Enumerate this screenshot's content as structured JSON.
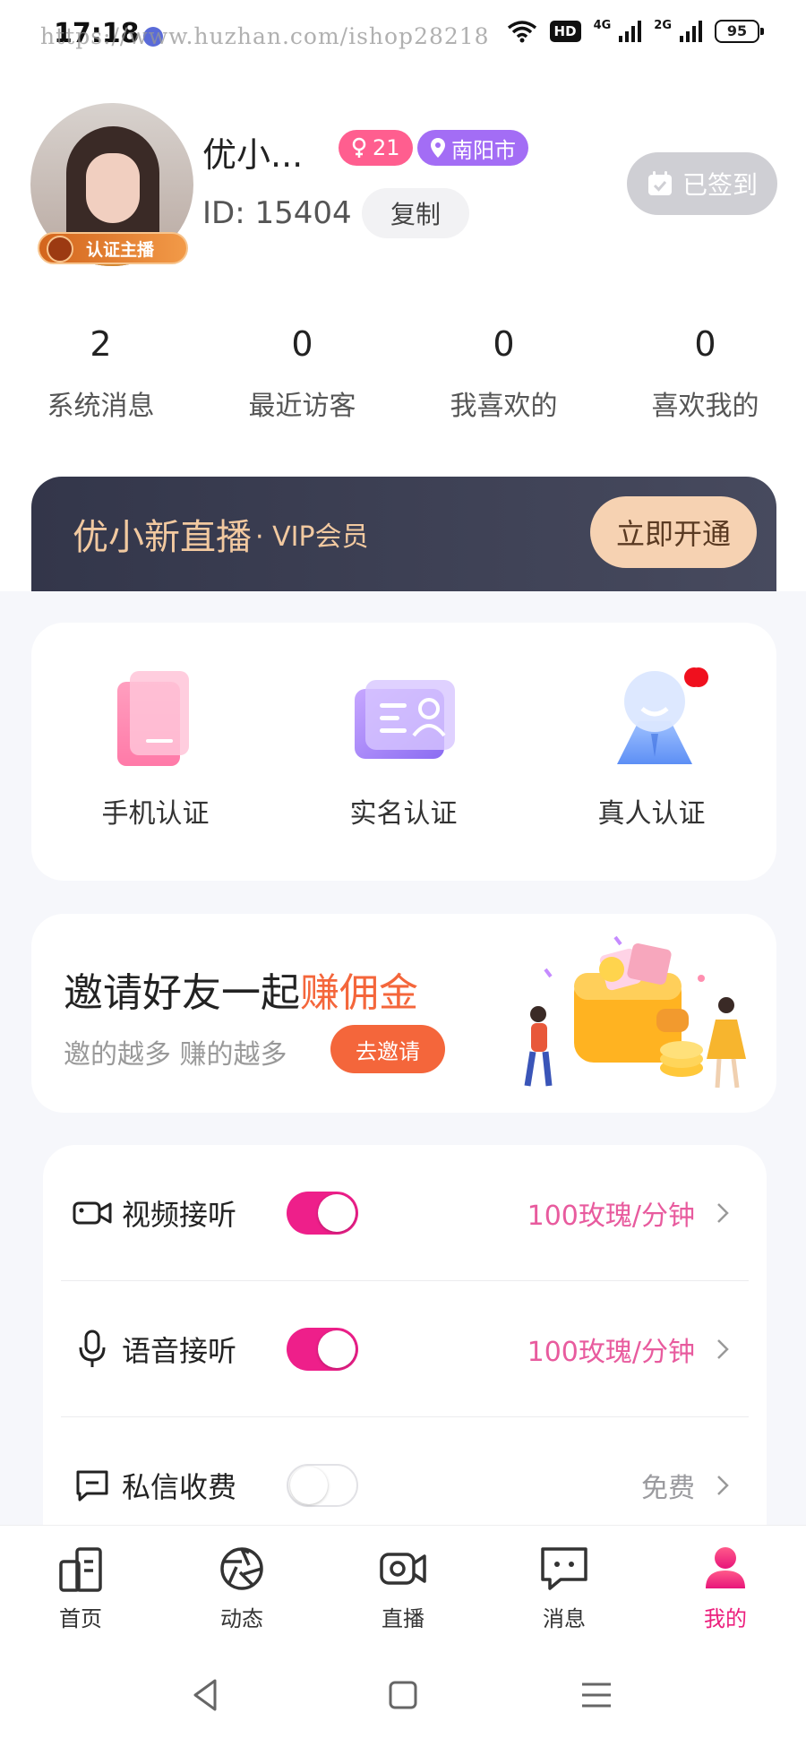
{
  "status_bar": {
    "time": "17:18",
    "watermark": "https://www.huzhan.com/ishop28218",
    "hd": "HD",
    "net1": "4G",
    "net2": "2G",
    "battery": "95"
  },
  "profile": {
    "nickname": "优小...",
    "age": "21",
    "city": "南阳市",
    "id_text": "ID: 15404",
    "copy_label": "复制",
    "cert_label": "认证主播",
    "signin_label": "已签到"
  },
  "stats": [
    {
      "value": "2",
      "label": "系统消息"
    },
    {
      "value": "0",
      "label": "最近访客"
    },
    {
      "value": "0",
      "label": "我喜欢的"
    },
    {
      "value": "0",
      "label": "喜欢我的"
    }
  ],
  "vip": {
    "title": "优小新直播",
    "subtitle": "· VIP会员",
    "button": "立即开通"
  },
  "verify": {
    "items": [
      {
        "label": "手机认证",
        "icon": "phone-icon",
        "has_dot": false
      },
      {
        "label": "实名认证",
        "icon": "id-card-icon",
        "has_dot": true
      },
      {
        "label": "真人认证",
        "icon": "person-icon",
        "has_dot": true
      }
    ]
  },
  "invite": {
    "title_main": "邀请好友一起",
    "title_highlight": "赚佣金",
    "subtitle": "邀的越多 赚的越多",
    "button": "去邀请"
  },
  "settings": {
    "rows": [
      {
        "label": "视频接听",
        "icon": "video-camera-icon",
        "toggle_on": true,
        "value": "100玫瑰/分钟"
      },
      {
        "label": "语音接听",
        "icon": "microphone-icon",
        "toggle_on": true,
        "value": "100玫瑰/分钟"
      },
      {
        "label": "私信收费",
        "icon": "message-icon",
        "toggle_on": false,
        "value": "免费"
      }
    ]
  },
  "bottom_nav": {
    "items": [
      {
        "label": "首页",
        "icon": "home-icon"
      },
      {
        "label": "动态",
        "icon": "aperture-icon"
      },
      {
        "label": "直播",
        "icon": "live-camera-icon"
      },
      {
        "label": "消息",
        "icon": "chat-icon"
      },
      {
        "label": "我的",
        "icon": "user-icon"
      }
    ],
    "active_index": 4
  },
  "colors": {
    "accent_pink": "#ee1f8a",
    "vip_gold": "#f2c9a0",
    "invite_orange": "#f4663b",
    "city_purple": "#a36df5",
    "age_pink": "#ff5e8f"
  }
}
